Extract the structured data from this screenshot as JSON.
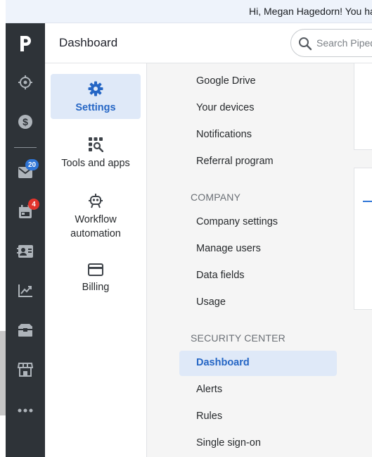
{
  "topbar": {
    "greeting": "Hi, Megan Hagedorn! You ha"
  },
  "header": {
    "title": "Dashboard"
  },
  "search": {
    "placeholder": "Search Piped"
  },
  "rail": {
    "items": [
      {
        "name": "deals-target-icon"
      },
      {
        "name": "dollar-icon"
      },
      {
        "name": "mail-icon",
        "badge": "20"
      },
      {
        "name": "calendar-icon",
        "badge": "4"
      },
      {
        "name": "contacts-icon"
      },
      {
        "name": "insights-icon"
      },
      {
        "name": "products-icon"
      },
      {
        "name": "marketplace-icon"
      },
      {
        "name": "more-icon"
      }
    ]
  },
  "categories": [
    {
      "label": "Settings",
      "icon": "gear-icon",
      "active": true
    },
    {
      "label": "Tools and apps",
      "icon": "tools-icon",
      "active": false
    },
    {
      "label": "Workflow automation",
      "icon": "robot-icon",
      "active": false
    },
    {
      "label": "Billing",
      "icon": "card-icon",
      "active": false
    }
  ],
  "links": {
    "personal": [
      "Google Drive",
      "Your devices",
      "Notifications",
      "Referral program"
    ],
    "company_heading": "COMPANY",
    "company": [
      "Company settings",
      "Manage users",
      "Data fields",
      "Usage"
    ],
    "security_heading": "SECURITY CENTER",
    "security": [
      "Dashboard",
      "Alerts",
      "Rules",
      "Single sign-on"
    ]
  },
  "colors": {
    "rail_bg": "#2e3338",
    "accent": "#2566c5",
    "active_bg": "#dfe9f8",
    "badge_blue": "#2f75d6",
    "badge_red": "#e2342c"
  }
}
